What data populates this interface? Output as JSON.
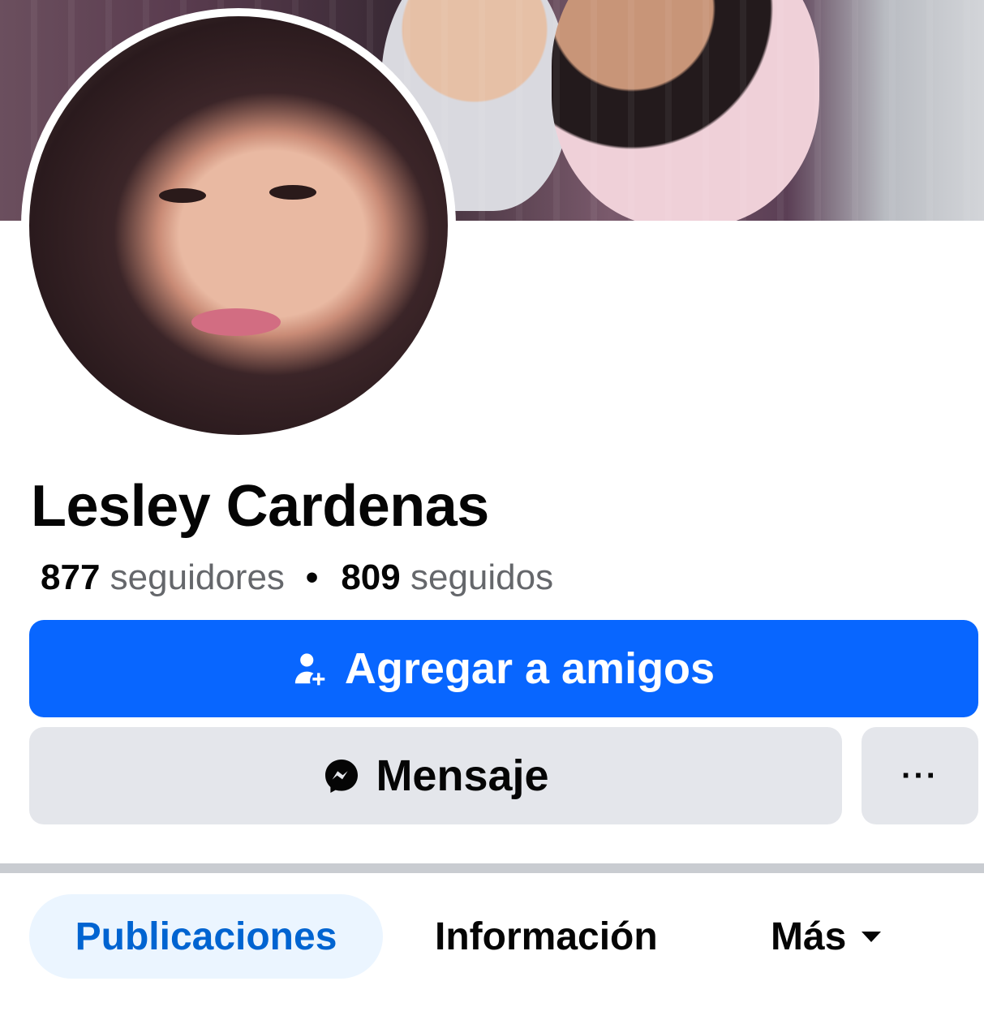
{
  "profile": {
    "name": "Lesley Cardenas",
    "followers_count": "877",
    "followers_label": "seguidores",
    "separator": "•",
    "following_count": "809",
    "following_label": "seguidos"
  },
  "actions": {
    "add_friend_label": "Agregar a amigos",
    "message_label": "Mensaje",
    "more_label": "···"
  },
  "tabs": [
    {
      "label": "Publicaciones",
      "active": true
    },
    {
      "label": "Información",
      "active": false
    },
    {
      "label": "Más",
      "active": false
    }
  ],
  "icons": {
    "add_friend": "person-add-icon",
    "message": "messenger-icon",
    "more_tab": "caret-down-icon"
  },
  "colors": {
    "primary": "#0866ff",
    "secondary_button": "#e4e6eb",
    "active_tab_bg": "#ebf5ff",
    "active_tab_text": "#0064d1",
    "muted_text": "#65676b"
  }
}
